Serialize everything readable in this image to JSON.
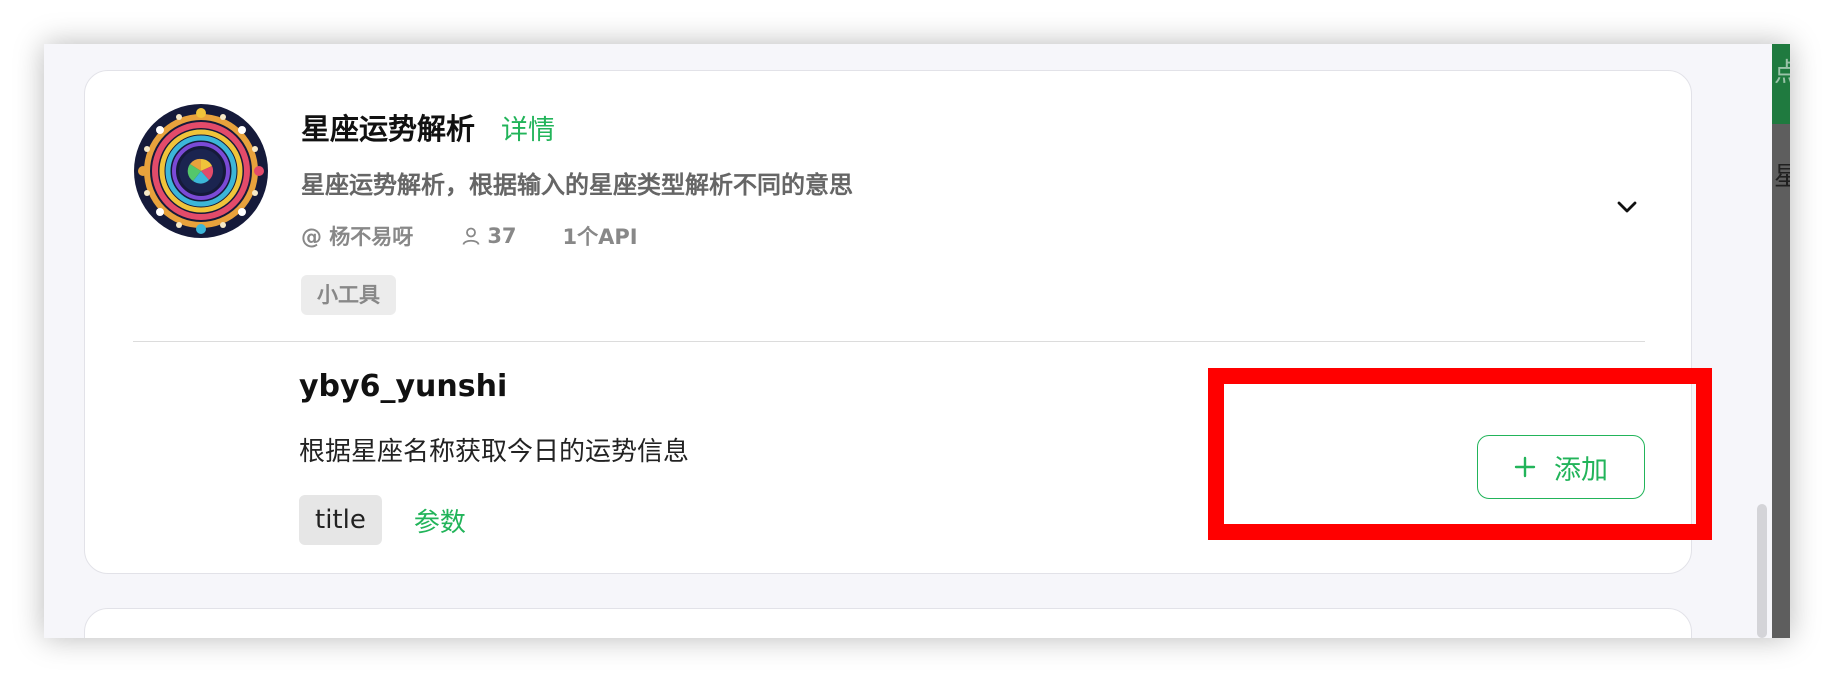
{
  "plugin": {
    "title": "星座运势解析",
    "detail_link": "详情",
    "description": "星座运势解析，根据输入的星座类型解析不同的意思",
    "author": "@ 杨不易呀",
    "user_count": "37",
    "api_count": "1个API",
    "tag": "小工具"
  },
  "api": {
    "name": "yby6_yunshi",
    "description": "根据星座名称获取今日的运势信息",
    "param_chip": "title",
    "param_label": "参数",
    "add_label": "添加"
  },
  "right_panel": {
    "chars": [
      "点",
      "星"
    ]
  },
  "icons": {
    "avatar": "zodiac-wheel-icon",
    "users": "user-icon",
    "expand": "chevron-down-icon",
    "add": "plus-icon"
  },
  "colors": {
    "accent": "#22b45a",
    "highlight": "#ff0000",
    "right_bar_top": "#1f7a3f",
    "right_bar": "#5e5e5e"
  }
}
